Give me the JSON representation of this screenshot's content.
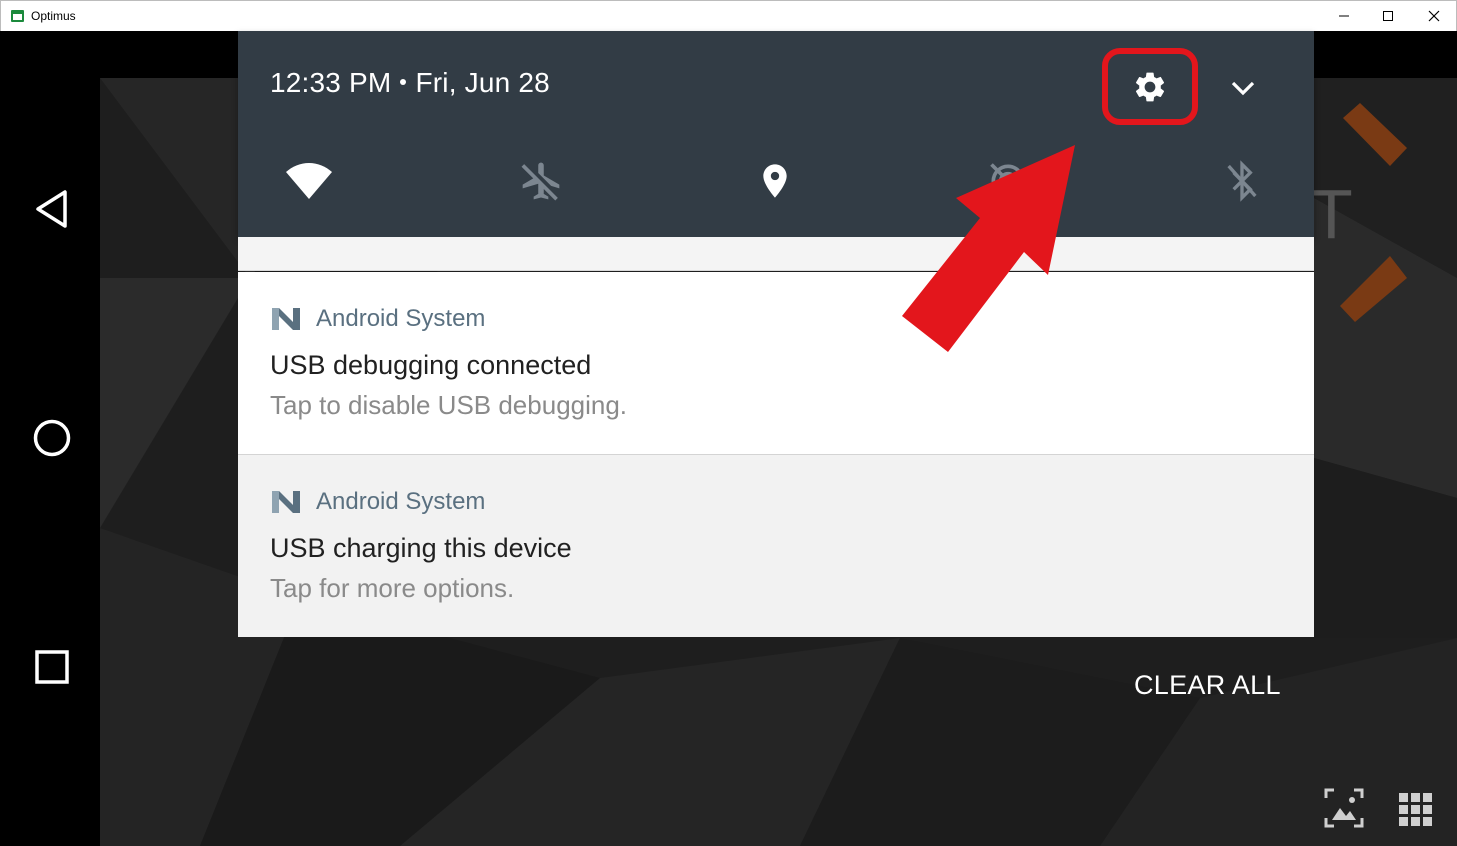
{
  "window": {
    "title": "Optimus",
    "minimize_icon": "minimize-icon",
    "maximize_icon": "maximize-icon",
    "close_icon": "close-icon"
  },
  "nav": {
    "back_icon": "back-triangle-icon",
    "home_icon": "home-circle-icon",
    "recents_icon": "recents-square-icon"
  },
  "shade": {
    "time": "12:33 PM",
    "date": "Fri, Jun 28",
    "settings_icon": "gear-icon",
    "expand_icon": "chevron-down-icon",
    "quick_settings": [
      {
        "name": "wifi",
        "icon": "wifi-icon",
        "state": "on"
      },
      {
        "name": "airplane-mode",
        "icon": "airplane-off-icon",
        "state": "off"
      },
      {
        "name": "location",
        "icon": "location-pin-icon",
        "state": "on"
      },
      {
        "name": "hotspot",
        "icon": "hotspot-off-icon",
        "state": "off"
      },
      {
        "name": "bluetooth",
        "icon": "bluetooth-off-icon",
        "state": "off"
      }
    ]
  },
  "notifications": [
    {
      "app": "Android System",
      "title": "USB debugging connected",
      "text": "Tap to disable USB debugging."
    },
    {
      "app": "Android System",
      "title": "USB charging this device",
      "text": "Tap for more options."
    }
  ],
  "clear_all": "CLEAR ALL",
  "annotation": {
    "color": "#e3161c",
    "highlight": "settings-gear"
  },
  "colors": {
    "shade_header": "#323c45",
    "notif_app": "#5a7080",
    "accent_red": "#e3161c"
  }
}
